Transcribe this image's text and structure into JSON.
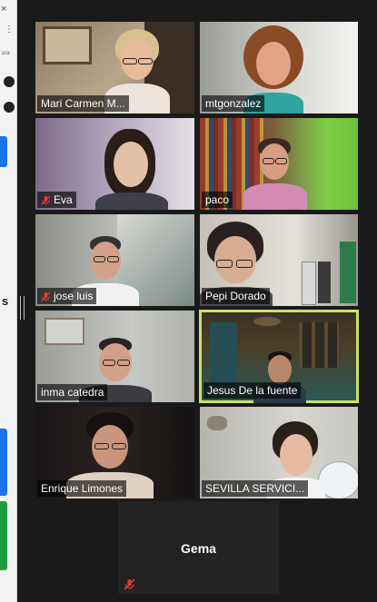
{
  "left_panel": {
    "close_glyph": "×",
    "menu_glyph": "⋮",
    "partial_text": "ura",
    "partial_heading": "s"
  },
  "participants": [
    {
      "name": "Mari Carmen M...",
      "muted": false,
      "active": false
    },
    {
      "name": "mtgonzalez",
      "muted": false,
      "active": false
    },
    {
      "name": "Eva",
      "muted": true,
      "active": false
    },
    {
      "name": "paco",
      "muted": false,
      "active": false
    },
    {
      "name": "jose luis",
      "muted": true,
      "active": false
    },
    {
      "name": "Pepi Dorado",
      "muted": false,
      "active": false
    },
    {
      "name": "inma catedra",
      "muted": false,
      "active": false
    },
    {
      "name": "Jesus De la fuente",
      "muted": false,
      "active": true
    },
    {
      "name": "Enrique Limones",
      "muted": false,
      "active": false
    },
    {
      "name": "SEVILLA SERVICI...",
      "muted": false,
      "active": false
    },
    {
      "name": "Gema",
      "muted": true,
      "active": false,
      "video": false
    }
  ],
  "colors": {
    "active_border": "#c9e265",
    "muted_icon": "#e53935",
    "background": "#1a1a1a"
  },
  "icons": {
    "muted": "mic-off-icon",
    "close": "close-icon"
  }
}
